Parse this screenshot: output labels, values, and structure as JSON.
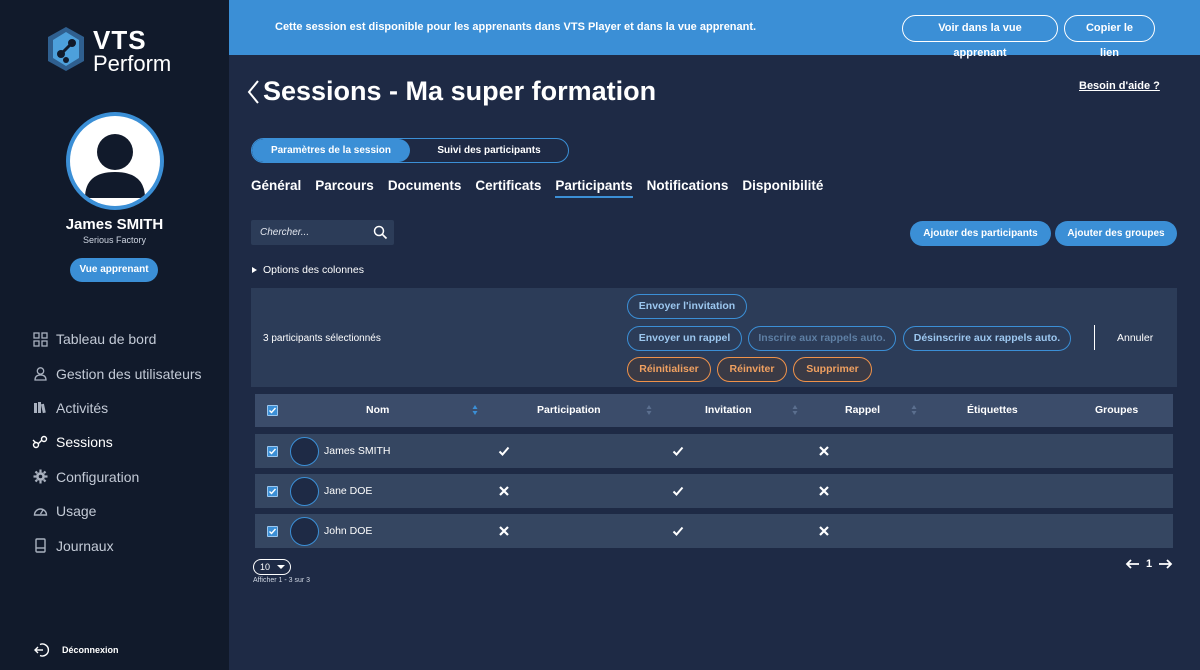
{
  "brand": {
    "line1": "VTS",
    "line2": "Perform"
  },
  "user": {
    "name": "James SMITH",
    "org": "Serious Factory",
    "learner_view_label": "Vue apprenant"
  },
  "sidebar": {
    "items": [
      {
        "label": "Tableau de bord",
        "icon": "dashboard-icon"
      },
      {
        "label": "Gestion des utilisateurs",
        "icon": "user-icon"
      },
      {
        "label": "Activités",
        "icon": "books-icon"
      },
      {
        "label": "Sessions",
        "icon": "sessions-icon",
        "active": true
      },
      {
        "label": "Configuration",
        "icon": "gear-icon"
      },
      {
        "label": "Usage",
        "icon": "gauge-icon"
      },
      {
        "label": "Journaux",
        "icon": "journal-icon"
      }
    ],
    "logout_label": "Déconnexion"
  },
  "banner": {
    "text": "Cette session est disponible pour les apprenants dans VTS Player et dans la vue apprenant.",
    "view_label": "Voir dans la vue apprenant",
    "copy_label": "Copier le lien"
  },
  "page": {
    "title": "Sessions - Ma super formation",
    "help": "Besoin d'aide ?"
  },
  "segment": {
    "settings": "Paramètres de la session",
    "tracking": "Suivi des participants"
  },
  "tabs": [
    "Général",
    "Parcours",
    "Documents",
    "Certificats",
    "Participants",
    "Notifications",
    "Disponibilité"
  ],
  "active_tab": "Participants",
  "search": {
    "placeholder": "Chercher..."
  },
  "actions": {
    "add_participants": "Ajouter des participants",
    "add_groups": "Ajouter des groupes"
  },
  "column_options": "Options des colonnes",
  "selection": {
    "text": "3 participants sélectionnés",
    "send_invite": "Envoyer l'invitation",
    "send_reminder": "Envoyer un rappel",
    "subscribe_auto": "Inscrire aux rappels auto.",
    "unsubscribe_auto": "Désinscrire aux rappels auto.",
    "reset": "Réinitialiser",
    "reinvite": "Réinviter",
    "delete": "Supprimer",
    "cancel": "Annuler"
  },
  "table": {
    "headers": [
      "Nom",
      "Participation",
      "Invitation",
      "Rappel",
      "Étiquettes",
      "Groupes"
    ],
    "rows": [
      {
        "name": "James SMITH",
        "participation": true,
        "invitation": true,
        "rappel": false
      },
      {
        "name": "Jane DOE",
        "participation": false,
        "invitation": true,
        "rappel": false
      },
      {
        "name": "John DOE",
        "participation": false,
        "invitation": true,
        "rappel": false
      }
    ]
  },
  "pagination": {
    "page_size": "10",
    "showing": "Afficher 1 - 3 sur 3",
    "current_page": "1"
  },
  "colors": {
    "accent": "#3b8fd6",
    "sidebar": "#111a2b",
    "background": "#1e2a45",
    "danger": "#f0924a"
  }
}
